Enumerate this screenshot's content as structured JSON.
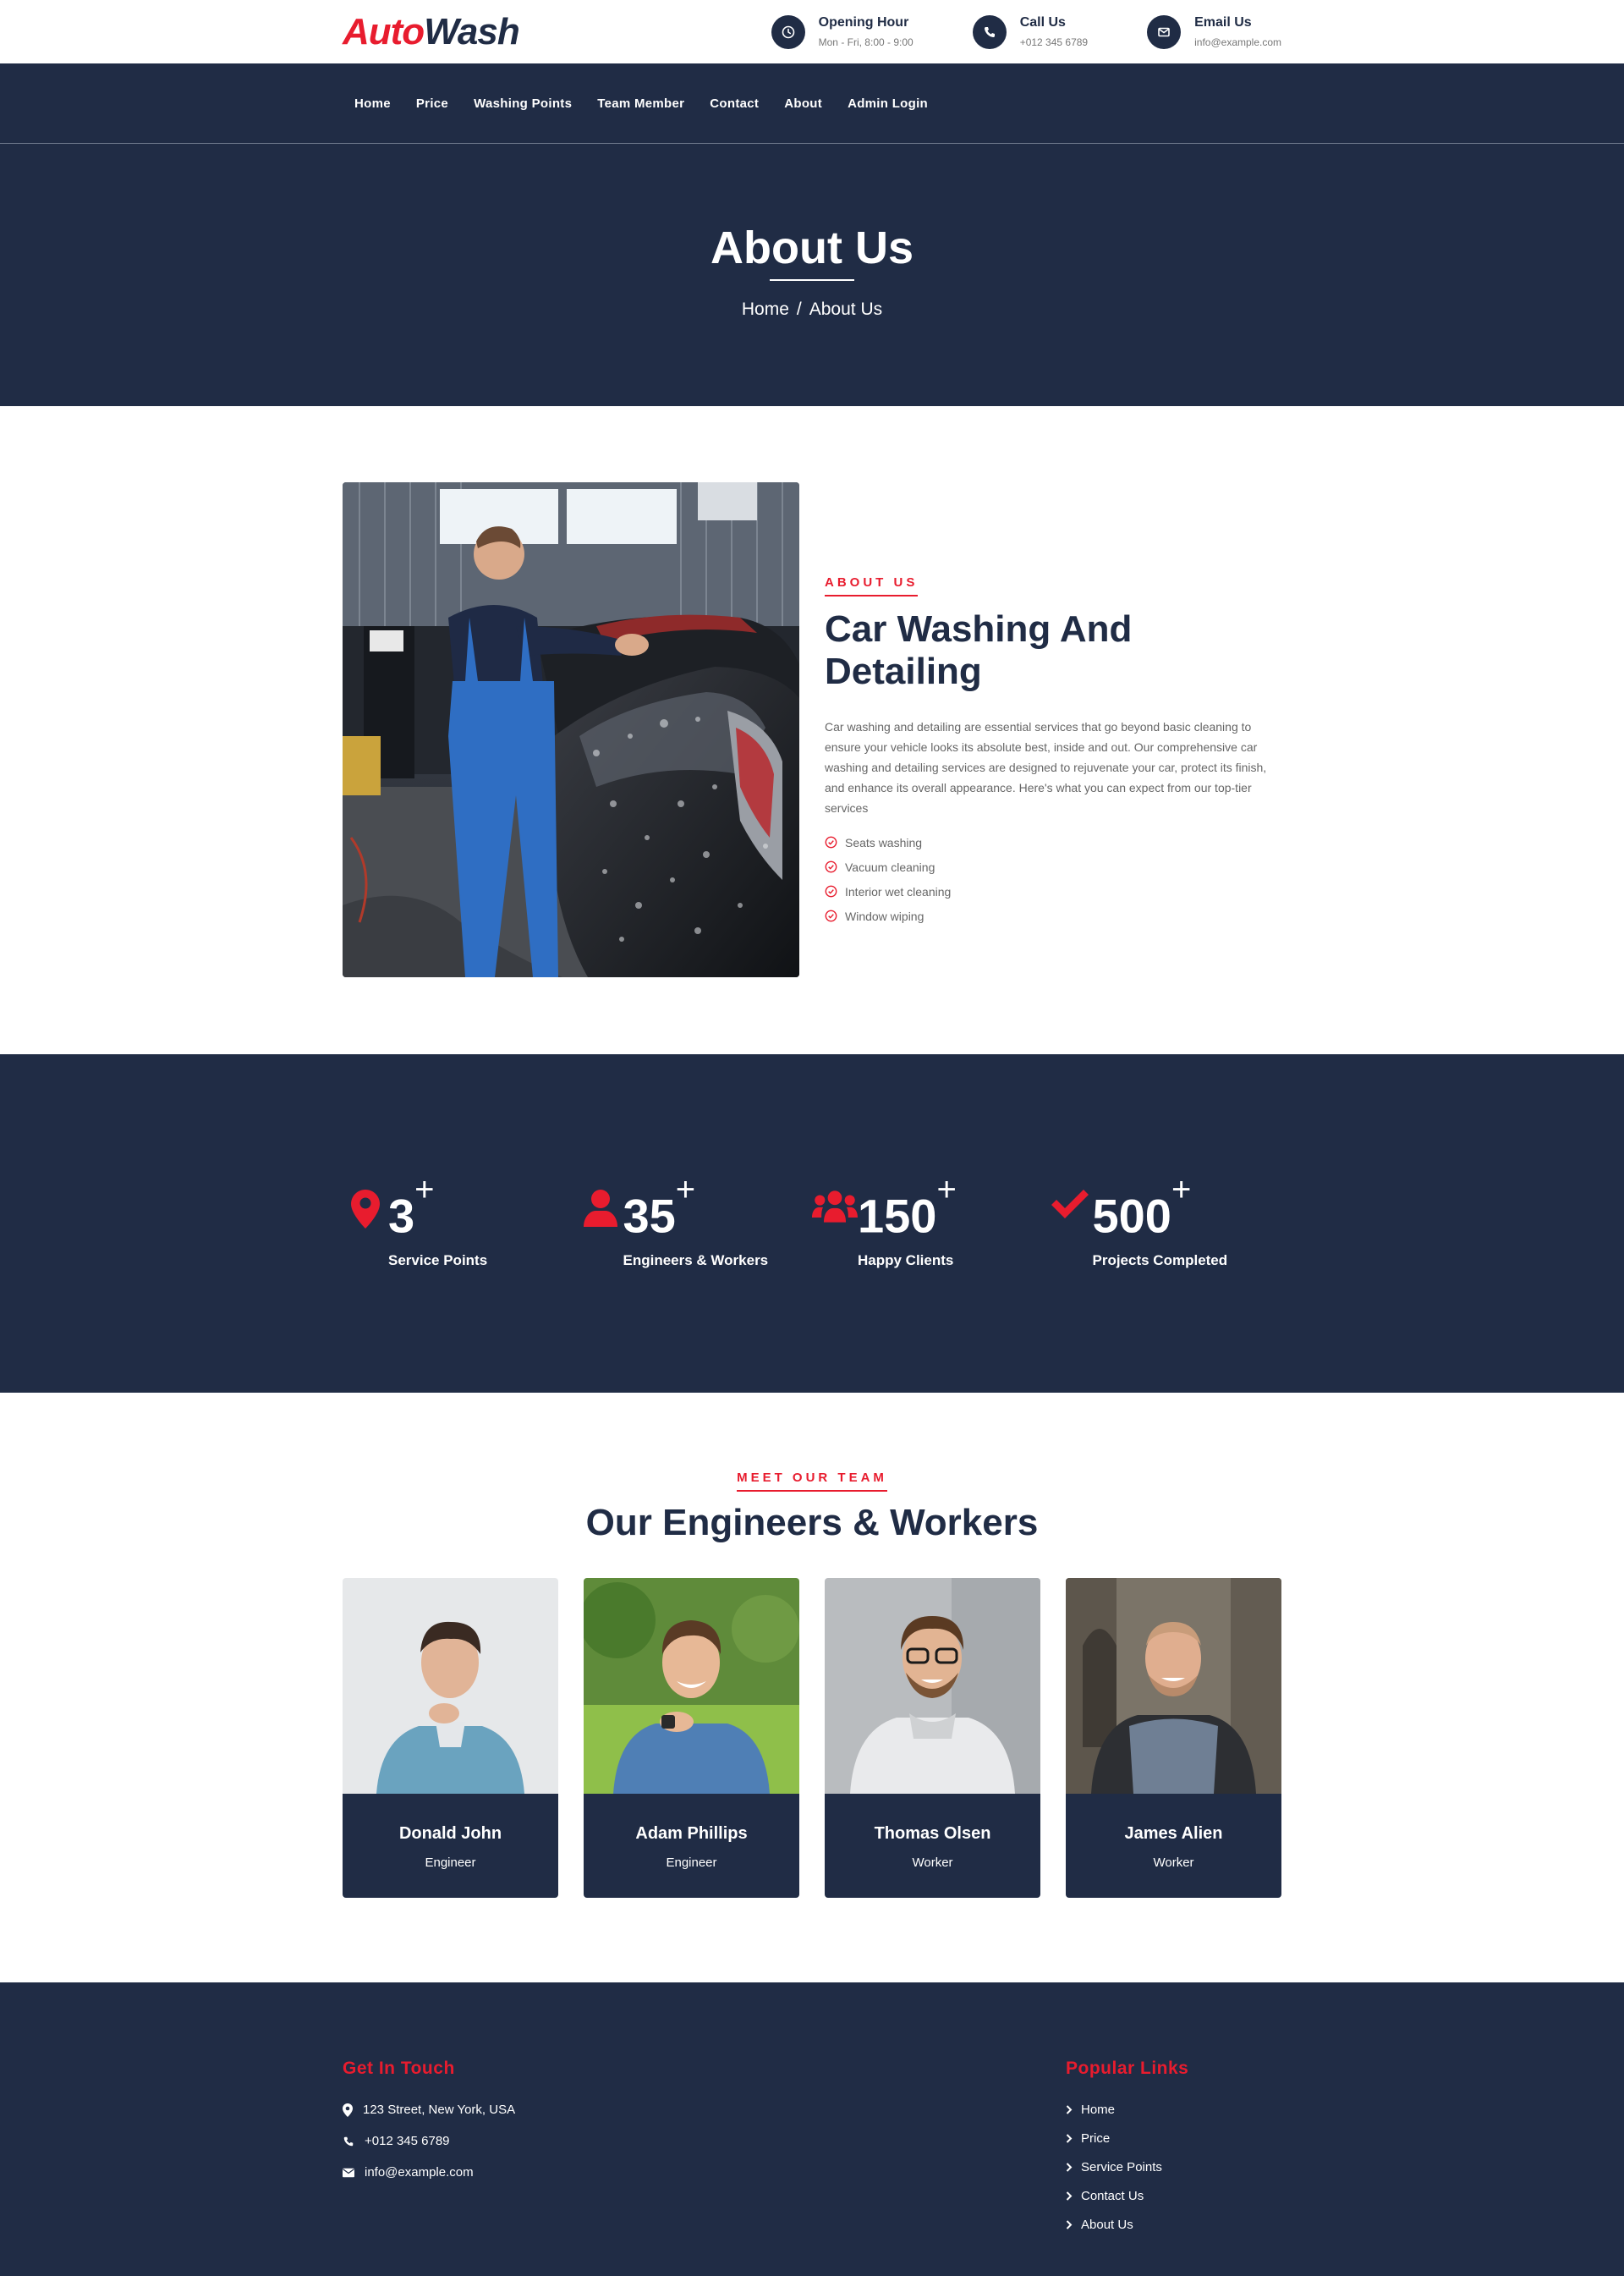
{
  "brand": {
    "part1": "Auto",
    "part2": "Wash"
  },
  "contacts": [
    {
      "title": "Opening Hour",
      "sub": "Mon - Fri, 8:00 - 9:00",
      "icon": "clock-icon"
    },
    {
      "title": "Call Us",
      "sub": "+012 345 6789",
      "icon": "phone-icon"
    },
    {
      "title": "Email Us",
      "sub": "info@example.com",
      "icon": "envelope-icon"
    }
  ],
  "nav": [
    "Home",
    "Price",
    "Washing Points",
    "Team Member",
    "Contact",
    "About",
    "Admin Login"
  ],
  "page_header": {
    "title": "About Us",
    "crumb_home": "Home",
    "crumb_sep": "/",
    "crumb_current": "About Us"
  },
  "about": {
    "tag": "ABOUT US",
    "title": "Car Washing And Detailing",
    "description": "Car washing and detailing are essential services that go beyond basic cleaning to ensure your vehicle looks its absolute best, inside and out. Our comprehensive car washing and detailing services are designed to rejuvenate your car, protect its finish, and enhance its overall appearance. Here's what you can expect from our top-tier services",
    "list": [
      "Seats washing",
      "Vacuum cleaning",
      "Interior wet cleaning",
      "Window wiping"
    ]
  },
  "facts": [
    {
      "number": "3",
      "plus": "+",
      "label": "Service Points",
      "icon": "map-marker-icon"
    },
    {
      "number": "35",
      "plus": "+",
      "label": "Engineers & Workers",
      "icon": "user-icon"
    },
    {
      "number": "150",
      "plus": "+",
      "label": "Happy Clients",
      "icon": "users-icon"
    },
    {
      "number": "500",
      "plus": "+",
      "label": "Projects Completed",
      "icon": "check-icon"
    }
  ],
  "team": {
    "tag": "MEET OUR TEAM",
    "title": "Our Engineers & Workers",
    "members": [
      {
        "name": "Donald John",
        "role": "Engineer"
      },
      {
        "name": "Adam Phillips",
        "role": "Engineer"
      },
      {
        "name": "Thomas Olsen",
        "role": "Worker"
      },
      {
        "name": "James Alien",
        "role": "Worker"
      }
    ]
  },
  "footer": {
    "contact_title": "Get In Touch",
    "address": "123 Street, New York, USA",
    "phone": "+012 345 6789",
    "email": "info@example.com",
    "links_title": "Popular Links",
    "links": [
      "Home",
      "Price",
      "Service Points",
      "Contact Us",
      "About Us"
    ]
  },
  "colors": {
    "primary": "#e81c2e",
    "dark": "#202c45"
  }
}
